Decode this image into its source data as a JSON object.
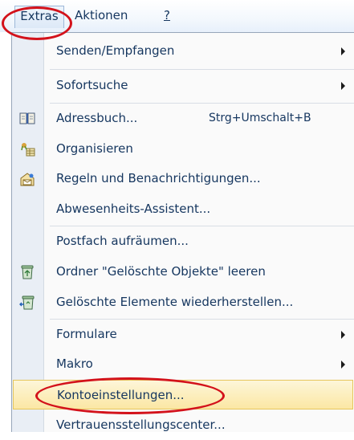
{
  "menubar": {
    "items": [
      {
        "label": "Extras"
      },
      {
        "label": "Aktionen"
      },
      {
        "label": "?"
      }
    ]
  },
  "menu": {
    "items": [
      {
        "label": "Senden/Empfangen",
        "submenu": true
      },
      {
        "label": "Sofortsuche",
        "submenu": true
      },
      {
        "label": "Adressbuch...",
        "shortcut": "Strg+Umschalt+B",
        "icon": "address-book-icon"
      },
      {
        "label": "Organisieren",
        "icon": "organize-icon"
      },
      {
        "label": "Regeln und Benachrichtigungen...",
        "icon": "rules-icon"
      },
      {
        "label": "Abwesenheits-Assistent..."
      },
      {
        "label": "Postfach aufräumen..."
      },
      {
        "label": "Ordner \"Gelöschte Objekte\" leeren",
        "icon": "empty-trash-icon"
      },
      {
        "label": "Gelöschte Elemente wiederherstellen...",
        "icon": "recover-deleted-icon"
      },
      {
        "label": "Formulare",
        "submenu": true
      },
      {
        "label": "Makro",
        "submenu": true
      },
      {
        "label": "Kontoeinstellungen...",
        "highlighted": true
      },
      {
        "label": "Vertrauensstellungscenter..."
      }
    ]
  },
  "colors": {
    "text": "#15365f",
    "highlight": "#fbe7a4",
    "annotation_ring": "#d3121b"
  }
}
